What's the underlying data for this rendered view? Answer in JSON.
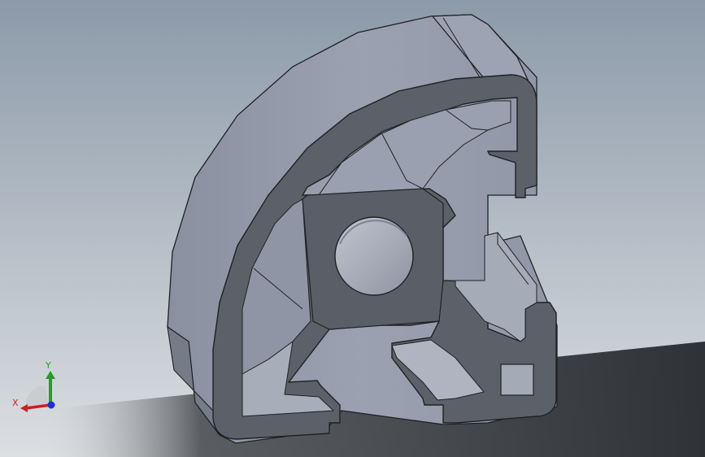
{
  "viewport": {
    "background_top": "#8c9aa9",
    "background_bottom": "#dcdfe2",
    "shadow_color": "#2f3236"
  },
  "model": {
    "face_color": "#5c6068",
    "face_edge": "#1f2125",
    "body_light": "#9da3b2",
    "body_mid": "#878d9c",
    "body_dark": "#6d7280",
    "slot_color": "#b0b4c0"
  },
  "triad": {
    "x_label": "X",
    "y_label": "Y",
    "x_color": "#cc1f1f",
    "y_color": "#1fa21f",
    "z_color": "#1f2fd0"
  }
}
